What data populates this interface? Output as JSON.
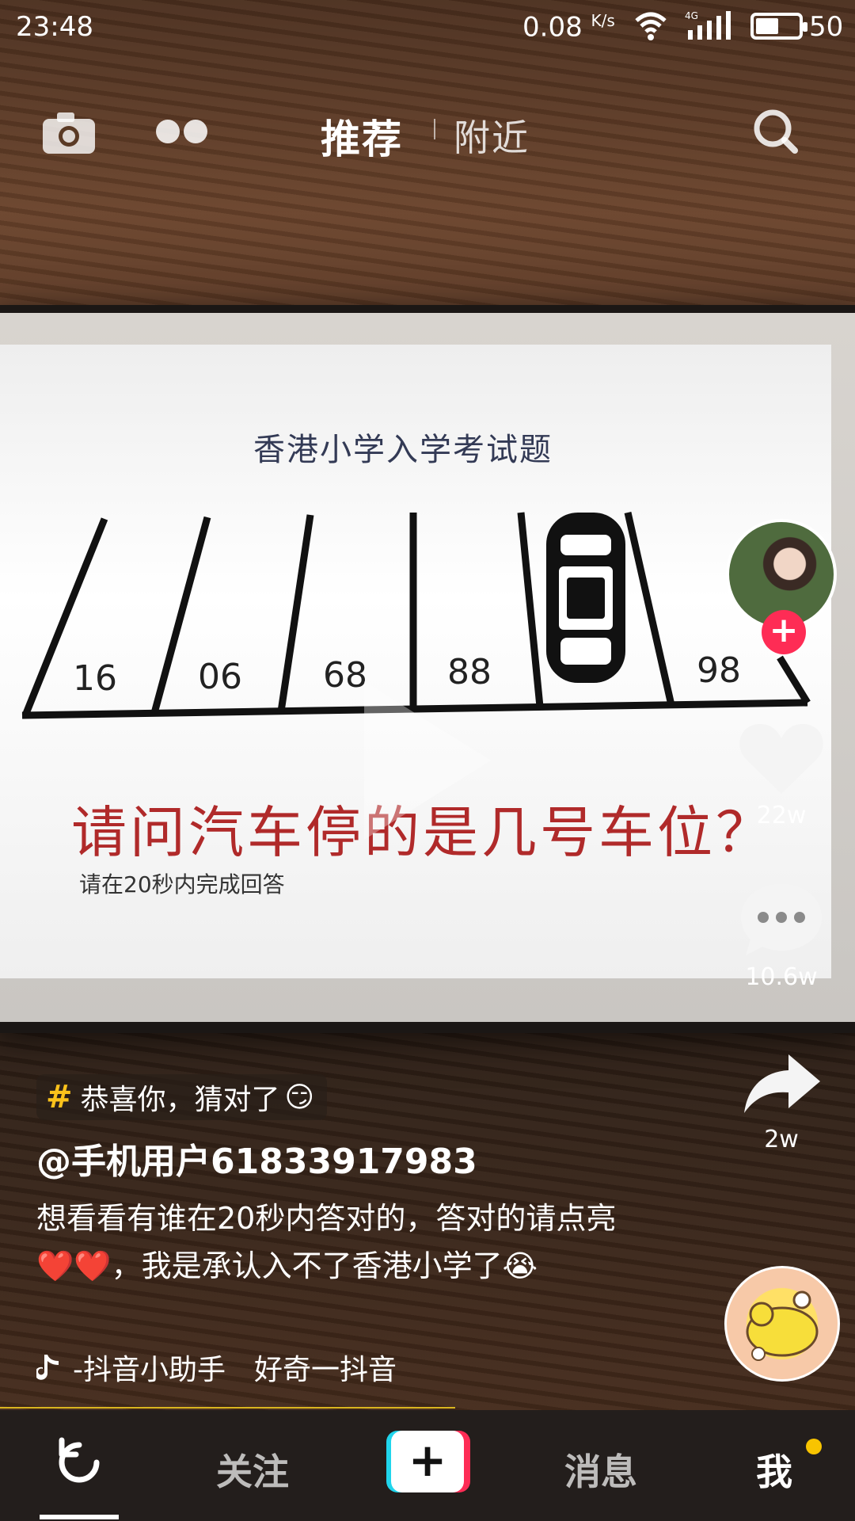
{
  "status_bar": {
    "time": "23:48",
    "net_speed": "0.08",
    "net_unit": "K/s",
    "network_type": "4G",
    "battery": "50"
  },
  "top_nav": {
    "tab_recommend": "推荐",
    "tab_nearby": "附近"
  },
  "video": {
    "puzzle_title": "香港小学入学考试题",
    "slots": [
      "16",
      "06",
      "68",
      "88",
      "",
      "98"
    ],
    "question": "请问汽车停的是几号车位？",
    "subtext": "请在20秒内完成回答"
  },
  "rail": {
    "likes": "22w",
    "comments": "10.6w",
    "shares": "2w"
  },
  "caption": {
    "hashtag": "恭喜你，猜对了",
    "hashtag_emoji": "😏",
    "username": "@手机用户61833917983",
    "description": "想看看有谁在20秒内答对的，答对的请点亮❤️❤️，我是承认入不了香港小学了😭",
    "music": "-抖音小助手　好奇一抖音"
  },
  "bottom_nav": {
    "follow": "关注",
    "messages": "消息",
    "me": "我",
    "add": "+"
  },
  "colors": {
    "accent_red": "#fe2c55",
    "accent_cyan": "#20d5ec",
    "hashtag_yellow": "#fcc21b",
    "notification_dot": "#f8c400"
  }
}
